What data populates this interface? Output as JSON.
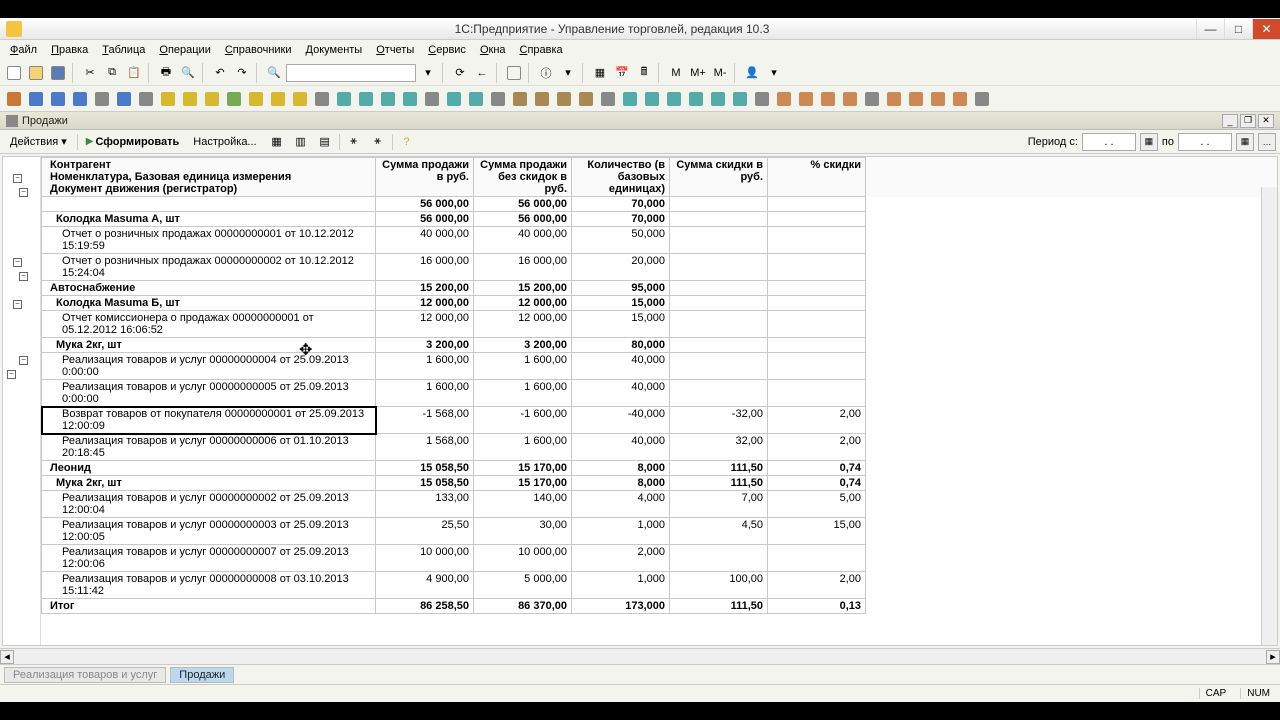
{
  "window": {
    "title": "1С:Предприятие - Управление торговлей, редакция 10.3"
  },
  "menu": [
    "Файл",
    "Правка",
    "Таблица",
    "Операции",
    "Справочники",
    "Документы",
    "Отчеты",
    "Сервис",
    "Окна",
    "Справка"
  ],
  "subwindow": {
    "title": "Продажи"
  },
  "actionbar": {
    "actions": "Действия",
    "generate": "Сформировать",
    "settings": "Настройка..."
  },
  "period": {
    "label": "Период с:",
    "from": ". .",
    "toLabel": "по",
    "to": ". ."
  },
  "columns": {
    "desc1": "Контрагент",
    "desc2": "Номенклатура, Базовая единица измерения",
    "desc3": "Документ движения (регистратор)",
    "c1": "Сумма продажи в руб.",
    "c2": "Сумма продажи без скидок в руб.",
    "c3": "Количество (в базовых единицах)",
    "c4": "Сумма скидки в руб.",
    "c5": "% скидки"
  },
  "rows": [
    {
      "lvl": 0,
      "bold": true,
      "desc": "",
      "v": [
        "56 000,00",
        "56 000,00",
        "70,000",
        "",
        ""
      ]
    },
    {
      "lvl": 1,
      "bold": true,
      "desc": "Колодка Masuma А, шт",
      "v": [
        "56 000,00",
        "56 000,00",
        "70,000",
        "",
        ""
      ]
    },
    {
      "lvl": 2,
      "desc": "Отчет о розничных продажах 00000000001 от 10.12.2012 15:19:59",
      "v": [
        "40 000,00",
        "40 000,00",
        "50,000",
        "",
        ""
      ]
    },
    {
      "lvl": 2,
      "desc": "Отчет о розничных продажах 00000000002 от 10.12.2012 15:24:04",
      "v": [
        "16 000,00",
        "16 000,00",
        "20,000",
        "",
        ""
      ]
    },
    {
      "lvl": 0,
      "bold": true,
      "desc": "Автоснабжение",
      "v": [
        "15 200,00",
        "15 200,00",
        "95,000",
        "",
        ""
      ]
    },
    {
      "lvl": 1,
      "bold": true,
      "desc": "Колодка Masuma Б, шт",
      "v": [
        "12 000,00",
        "12 000,00",
        "15,000",
        "",
        ""
      ]
    },
    {
      "lvl": 2,
      "desc": "Отчет комиссионера о продажах 00000000001 от 05.12.2012 16:06:52",
      "v": [
        "12 000,00",
        "12 000,00",
        "15,000",
        "",
        ""
      ]
    },
    {
      "lvl": 1,
      "bold": true,
      "desc": "Мука 2кг, шт",
      "v": [
        "3 200,00",
        "3 200,00",
        "80,000",
        "",
        ""
      ]
    },
    {
      "lvl": 2,
      "desc": "Реализация товаров и услуг 00000000004 от 25.09.2013 0:00:00",
      "v": [
        "1 600,00",
        "1 600,00",
        "40,000",
        "",
        ""
      ]
    },
    {
      "lvl": 2,
      "desc": "Реализация товаров и услуг 00000000005 от 25.09.2013 0:00:00",
      "v": [
        "1 600,00",
        "1 600,00",
        "40,000",
        "",
        ""
      ]
    },
    {
      "lvl": 2,
      "sel": true,
      "desc": "Возврат товаров от покупателя 00000000001 от 25.09.2013 12:00:09",
      "v": [
        "-1 568,00",
        "-1 600,00",
        "-40,000",
        "-32,00",
        "2,00"
      ]
    },
    {
      "lvl": 2,
      "desc": "Реализация товаров и услуг 00000000006 от 01.10.2013 20:18:45",
      "v": [
        "1 568,00",
        "1 600,00",
        "40,000",
        "32,00",
        "2,00"
      ]
    },
    {
      "lvl": 0,
      "bold": true,
      "desc": "Леонид",
      "v": [
        "15 058,50",
        "15 170,00",
        "8,000",
        "111,50",
        "0,74"
      ]
    },
    {
      "lvl": 1,
      "bold": true,
      "desc": "Мука 2кг, шт",
      "v": [
        "15 058,50",
        "15 170,00",
        "8,000",
        "111,50",
        "0,74"
      ]
    },
    {
      "lvl": 2,
      "desc": "Реализация товаров и услуг 00000000002 от 25.09.2013 12:00:04",
      "v": [
        "133,00",
        "140,00",
        "4,000",
        "7,00",
        "5,00"
      ]
    },
    {
      "lvl": 2,
      "desc": "Реализация товаров и услуг 00000000003 от 25.09.2013 12:00:05",
      "v": [
        "25,50",
        "30,00",
        "1,000",
        "4,50",
        "15,00"
      ]
    },
    {
      "lvl": 2,
      "desc": "Реализация товаров и услуг 00000000007 от 25.09.2013 12:00:06",
      "v": [
        "10 000,00",
        "10 000,00",
        "2,000",
        "",
        ""
      ]
    },
    {
      "lvl": 2,
      "desc": "Реализация товаров и услуг 00000000008 от 03.10.2013 15:11:42",
      "v": [
        "4 900,00",
        "5 000,00",
        "1,000",
        "100,00",
        "2,00"
      ]
    },
    {
      "lvl": 0,
      "bold": true,
      "desc": "Итог",
      "v": [
        "86 258,50",
        "86 370,00",
        "173,000",
        "111,50",
        "0,13"
      ]
    }
  ],
  "tasks": [
    {
      "label": "Реализация товаров и услуг",
      "active": false
    },
    {
      "label": "Продажи",
      "active": true
    }
  ],
  "status": {
    "cap": "CAP",
    "num": "NUM"
  },
  "toolbar_text": {
    "m": "M",
    "mp": "M+",
    "mm": "M-"
  }
}
